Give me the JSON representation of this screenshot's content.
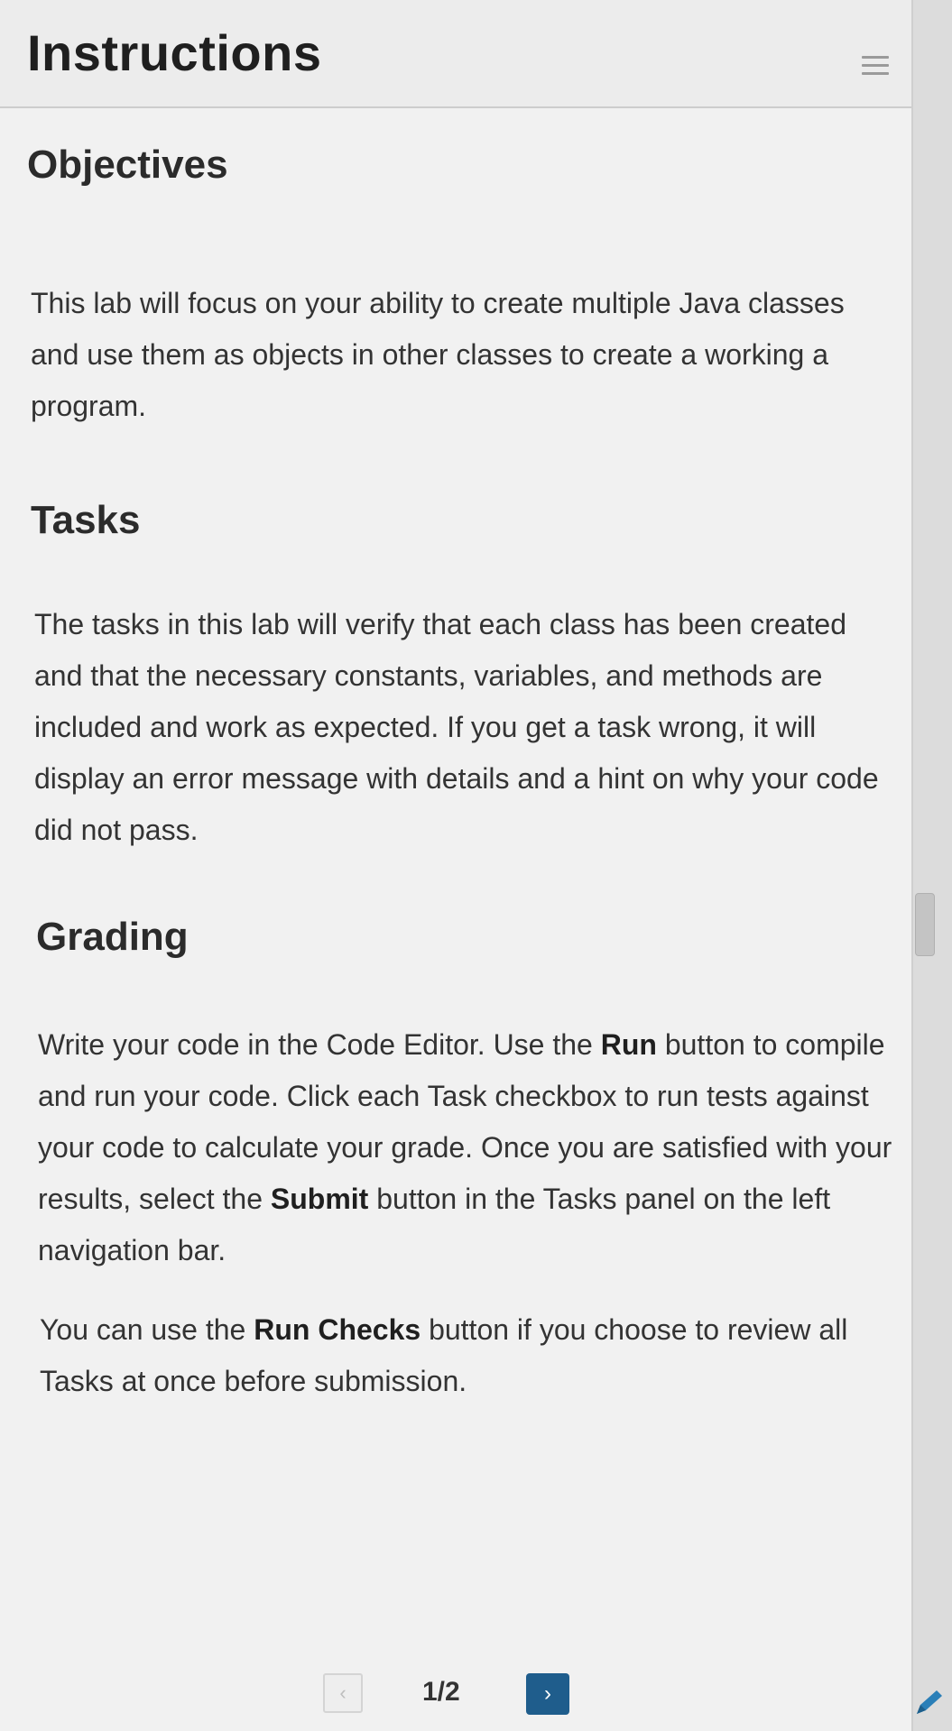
{
  "header": {
    "title": "Instructions",
    "menu_icon": "menu-icon"
  },
  "sections": [
    {
      "heading": "Objectives",
      "paragraphs": [
        "This lab will focus on your ability to create multiple Java classes and use them as objects in other classes to create a working a program."
      ]
    },
    {
      "heading": "Tasks",
      "paragraphs": [
        "The tasks in this lab will verify that each class has been created and that the necessary constants, variables, and methods are included and work as expected. If you get a task wrong, it will display an error message with details and a hint on why your code did not pass."
      ]
    },
    {
      "heading": "Grading",
      "paragraphs": [
        {
          "p1": "Write your code in the Code Editor. Use the ",
          "b1": "Run",
          "p2": " button to compile and run your code. Click each Task checkbox to run tests against your code to calculate your grade. Once you are satisfied with your results, select the ",
          "b2": "Submit",
          "p3": " button in the Tasks panel on the left navigation bar."
        },
        {
          "p1": "You can use the ",
          "b1": "Run Checks",
          "p2": " button if you choose to review all Tasks at once before submission."
        }
      ]
    }
  ],
  "pagination": {
    "prev_label": "‹",
    "indicator": "1/2",
    "next_label": "›"
  },
  "icons": {
    "edit": "pencil-icon"
  },
  "colors": {
    "accent": "#1f5d8c",
    "edit_icon": "#2a7fb8"
  }
}
